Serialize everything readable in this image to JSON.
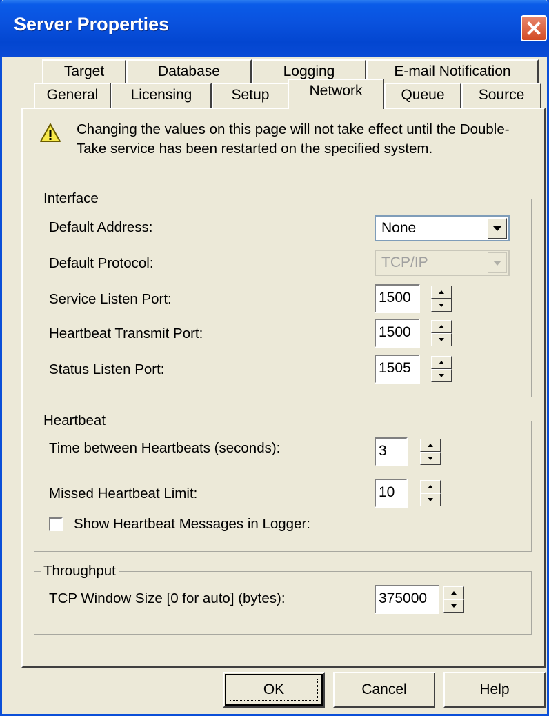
{
  "window": {
    "title": "Server Properties"
  },
  "tabs": {
    "row1": [
      {
        "label": "Target"
      },
      {
        "label": "Database"
      },
      {
        "label": "Logging"
      },
      {
        "label": "E-mail Notification"
      }
    ],
    "row2": [
      {
        "label": "General"
      },
      {
        "label": "Licensing"
      },
      {
        "label": "Setup"
      },
      {
        "label": "Network",
        "active": true
      },
      {
        "label": "Queue"
      },
      {
        "label": "Source"
      }
    ]
  },
  "warning": {
    "icon": "warning-icon",
    "text": "Changing the values on this page will not take effect until the Double-Take service has been restarted on the specified system."
  },
  "interface": {
    "title": "Interface",
    "default_address": {
      "label": "Default Address:",
      "value": "None"
    },
    "default_protocol": {
      "label": "Default Protocol:",
      "value": "TCP/IP",
      "disabled": true
    },
    "service_listen_port": {
      "label": "Service Listen Port:",
      "value": "1500"
    },
    "heartbeat_transmit_port": {
      "label": "Heartbeat Transmit Port:",
      "value": "1500"
    },
    "status_listen_port": {
      "label": "Status Listen Port:",
      "value": "1505"
    }
  },
  "heartbeat": {
    "title": "Heartbeat",
    "time_between": {
      "label": "Time between Heartbeats (seconds):",
      "value": "3"
    },
    "missed_limit": {
      "label": "Missed Heartbeat Limit:",
      "value": "10"
    },
    "show_messages": {
      "label": "Show Heartbeat Messages in Logger:",
      "checked": false
    }
  },
  "throughput": {
    "title": "Throughput",
    "tcp_window": {
      "label": "TCP Window Size [0 for auto] (bytes):",
      "value": "375000"
    }
  },
  "buttons": {
    "ok": "OK",
    "cancel": "Cancel",
    "help": "Help"
  }
}
